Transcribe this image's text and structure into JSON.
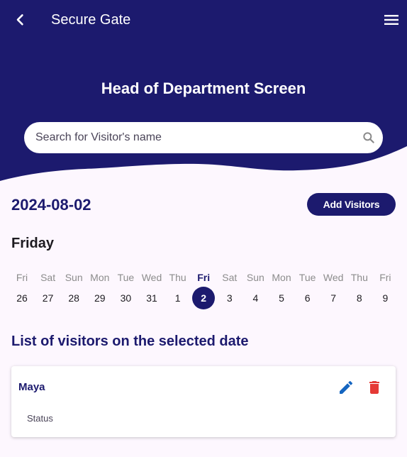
{
  "appbar": {
    "title": "Secure Gate",
    "back_icon": "chevron-left-icon",
    "menu_icon": "hamburger-menu-icon"
  },
  "header": {
    "screen_title": "Head of Department Screen"
  },
  "search": {
    "placeholder": "Search for Visitor's name",
    "value": "",
    "icon": "search-icon"
  },
  "date_bar": {
    "selected_date": "2024-08-02",
    "add_button_label": "Add Visitors"
  },
  "calendar": {
    "selected_day_name": "Friday",
    "days": [
      {
        "dow": "Fri",
        "num": "26",
        "selected": false
      },
      {
        "dow": "Sat",
        "num": "27",
        "selected": false
      },
      {
        "dow": "Sun",
        "num": "28",
        "selected": false
      },
      {
        "dow": "Mon",
        "num": "29",
        "selected": false
      },
      {
        "dow": "Tue",
        "num": "30",
        "selected": false
      },
      {
        "dow": "Wed",
        "num": "31",
        "selected": false
      },
      {
        "dow": "Thu",
        "num": "1",
        "selected": false
      },
      {
        "dow": "Fri",
        "num": "2",
        "selected": true
      },
      {
        "dow": "Sat",
        "num": "3",
        "selected": false
      },
      {
        "dow": "Sun",
        "num": "4",
        "selected": false
      },
      {
        "dow": "Mon",
        "num": "5",
        "selected": false
      },
      {
        "dow": "Tue",
        "num": "6",
        "selected": false
      },
      {
        "dow": "Wed",
        "num": "7",
        "selected": false
      },
      {
        "dow": "Thu",
        "num": "8",
        "selected": false
      },
      {
        "dow": "Fri",
        "num": "9",
        "selected": false
      }
    ]
  },
  "visitors": {
    "heading": "List of visitors on the selected date",
    "items": [
      {
        "name": "Maya",
        "status_label": "Status"
      }
    ],
    "edit_icon": "pencil-icon",
    "delete_icon": "trash-icon"
  },
  "colors": {
    "primary": "#1c1a6e",
    "background": "#fdf7fe",
    "edit": "#1565c0",
    "delete": "#e53935"
  }
}
